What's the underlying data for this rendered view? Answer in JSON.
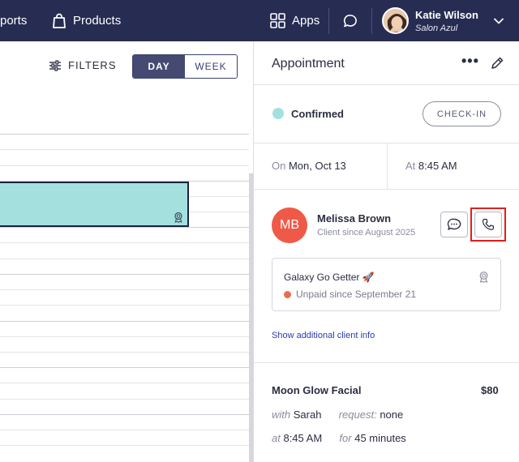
{
  "topbar": {
    "reports_partial": "ports",
    "products_label": "Products",
    "apps_label": "Apps",
    "user_name": "Katie Wilson",
    "user_salon": "Salon Azul",
    "icons": [
      "shopping-bag-icon",
      "grid-icon",
      "chat-bubble-icon",
      "chevron-down-icon"
    ]
  },
  "calendar": {
    "filters_label": "FILTERS",
    "view_toggle": [
      {
        "label": "DAY",
        "selected": true
      },
      {
        "label": "WEEK",
        "selected": false
      }
    ]
  },
  "appointment": {
    "title": "Appointment",
    "more_label": "•••",
    "status": "Confirmed",
    "status_color": "#a4e0de",
    "checkin_label": "CHECK-IN",
    "date_prefix": "On",
    "date": "Mon, Oct 13",
    "time_prefix": "At",
    "time": "8:45 AM"
  },
  "client": {
    "initials": "MB",
    "name": "Melissa Brown",
    "since": "Client since August 2025",
    "avatar_color": "#ee5a47",
    "membership": "Galaxy Go Getter 🚀",
    "payment_status": "Unpaid since September 21",
    "payment_status_color": "#ed6b4a",
    "more_info_link": "Show additional client info"
  },
  "service": {
    "name": "Moon Glow Facial",
    "price": "$80",
    "with_label": "with",
    "staff": "Sarah",
    "request_label": "request:",
    "request_value": "none",
    "at_label": "at",
    "time": "8:45 AM",
    "for_label": "for",
    "duration": "45 minutes"
  },
  "colors": {
    "nav_bg": "#262c52",
    "accent": "#454a72",
    "highlight": "#e11e1e"
  }
}
